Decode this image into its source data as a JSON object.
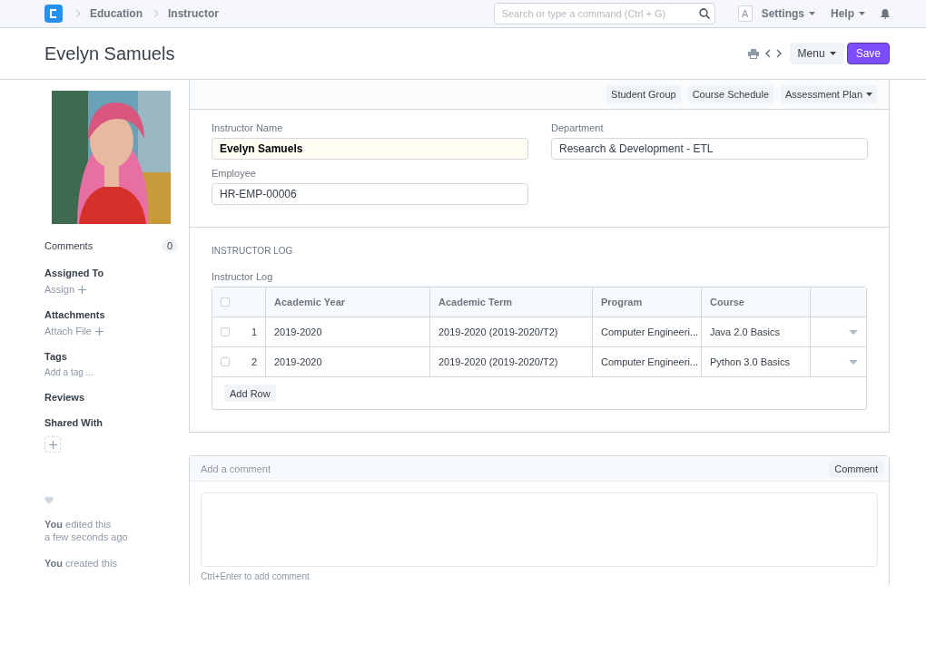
{
  "navbar": {
    "breadcrumbs": [
      "Education",
      "Instructor"
    ],
    "search": {
      "placeholder": "Search or type a command (Ctrl + G)"
    },
    "avatar": "A",
    "menus": [
      "Settings",
      "Help"
    ]
  },
  "page": {
    "title": "Evelyn Samuels",
    "menu_button": "Menu",
    "save_button": "Save"
  },
  "sidebar": {
    "comments": {
      "label": "Comments",
      "count": "0"
    },
    "sections": [
      {
        "kind": "add",
        "title": "Assigned To",
        "action": "Assign"
      },
      {
        "kind": "add",
        "title": "Attachments",
        "action": "Attach File"
      },
      {
        "kind": "tag",
        "title": "Tags",
        "action": "Add a tag ..."
      },
      {
        "kind": "plain",
        "title": "Reviews"
      },
      {
        "kind": "share",
        "title": "Shared With"
      }
    ],
    "liked": false,
    "timeline": [
      {
        "text": "**You** edited this",
        "time": "a few seconds ago"
      },
      {
        "text": "**You** created this"
      }
    ]
  },
  "form": {
    "toolbar": [
      {
        "label": "Student Group",
        "dropdown": false
      },
      {
        "label": "Course Schedule",
        "dropdown": false
      },
      {
        "label": "Assessment Plan",
        "dropdown": true
      }
    ],
    "columns": [
      [
        {
          "label": "Instructor Name",
          "value": "Evelyn Samuels",
          "emphasized": true
        },
        {
          "label": "Employee",
          "value": "HR-EMP-00006",
          "emphasized": false
        }
      ],
      [
        {
          "label": "Department",
          "value": "Research & Development - ETL",
          "emphasized": false
        }
      ]
    ],
    "section": {
      "heading": "INSTRUCTOR LOG",
      "label": "Instructor Log",
      "table": {
        "all_selected": false,
        "columns": [
          "Academic Year",
          "Academic Term",
          "Program",
          "Course"
        ],
        "rows": [
          {
            "index": "1",
            "selected": false,
            "cells": [
              "2019-2020",
              "2019-2020 (2019-2020/T2)",
              "Computer Engineeri...",
              "Java 2.0 Basics"
            ]
          },
          {
            "index": "2",
            "selected": false,
            "cells": [
              "2019-2020",
              "2019-2020 (2019-2020/T2)",
              "Computer Engineeri...",
              "Python 3.0 Basics"
            ]
          }
        ],
        "add_row": "Add Row"
      }
    }
  },
  "comment": {
    "title": "Add a comment",
    "button": "Comment",
    "hint": "Ctrl+Enter to add comment"
  }
}
